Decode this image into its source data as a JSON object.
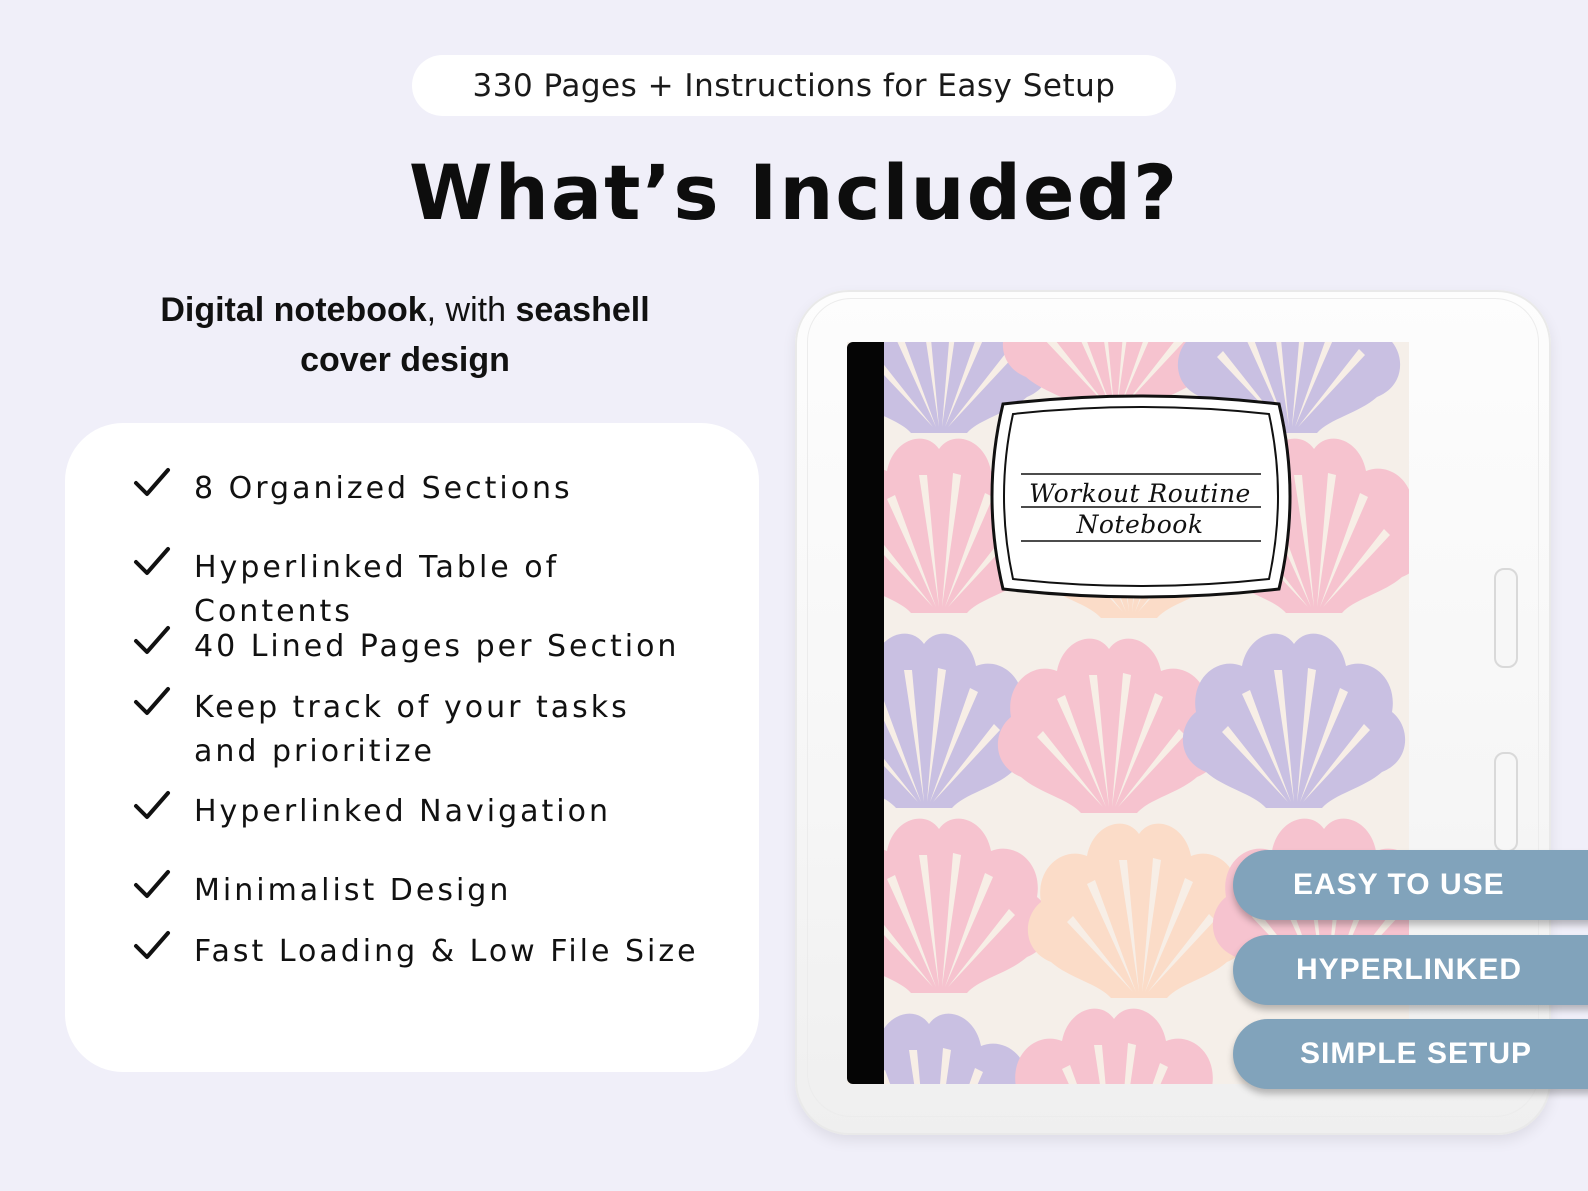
{
  "header": {
    "pill": "330 Pages + Instructions for Easy Setup",
    "title": "What’s Included?"
  },
  "subtitle": {
    "bold1": "Digital notebook",
    "plain": ", with ",
    "bold2": "seashell",
    "line2": "cover design"
  },
  "features": [
    "8 Organized Sections",
    "Hyperlinked Table of Contents",
    "40 Lined Pages per Section",
    "Keep track of your tasks and prioritize",
    "Hyperlinked Navigation",
    "Minimalist Design",
    "Fast Loading & Low File Size"
  ],
  "notebook": {
    "label_line1": "Workout Routine",
    "label_line2": "Notebook"
  },
  "tags": [
    "EASY TO USE",
    "HYPERLINKED",
    "SIMPLE SETUP"
  ],
  "icons": {
    "feature_bullet": "check-icon",
    "shell": "seashell-icon"
  },
  "colors": {
    "background": "#f0eff9",
    "tag": "#81a3bb",
    "shell_purple": "#c9c0e2",
    "shell_pink": "#f6c3cf",
    "shell_peach": "#fbdcc8"
  }
}
